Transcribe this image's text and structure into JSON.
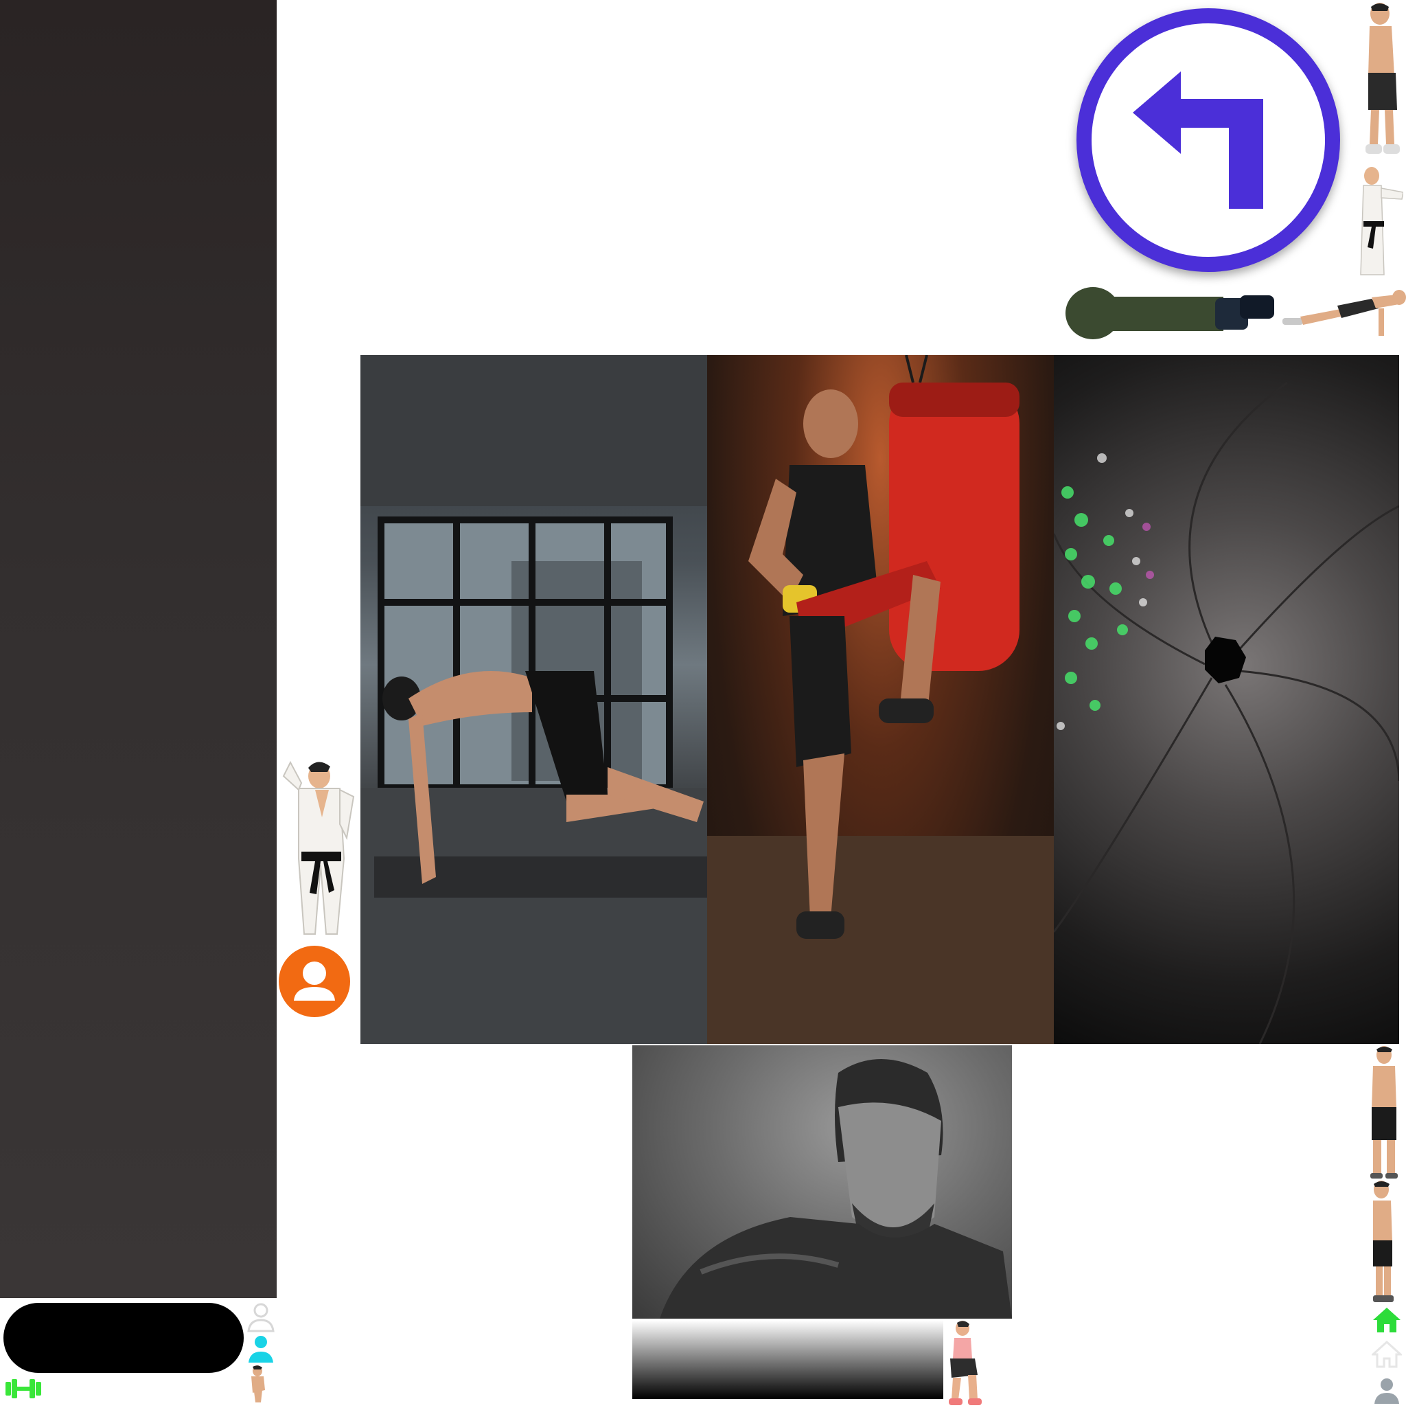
{
  "colors": {
    "accent_purple": "#4b2fd8",
    "profile_orange": "#f26a12",
    "home_green": "#2ddc3a",
    "dumbbell_green": "#39e639",
    "user_cyan": "#19d3e6",
    "user_gray": "#9aa3aa"
  },
  "icons": {
    "back": "turn-left-arrow-icon",
    "profile": "user-circle-icon",
    "home_active": "home-icon",
    "home_inactive": "home-outline-icon",
    "user_inactive": "user-icon",
    "user_active": "user-icon",
    "dumbbell": "dumbbell-icon"
  },
  "gallery": {
    "items": [
      {
        "name": "mountain-climber-photo"
      },
      {
        "name": "knee-strike-punching-bag-photo"
      },
      {
        "name": "camera-aperture-photo"
      },
      {
        "name": "portrait-photo"
      }
    ]
  }
}
